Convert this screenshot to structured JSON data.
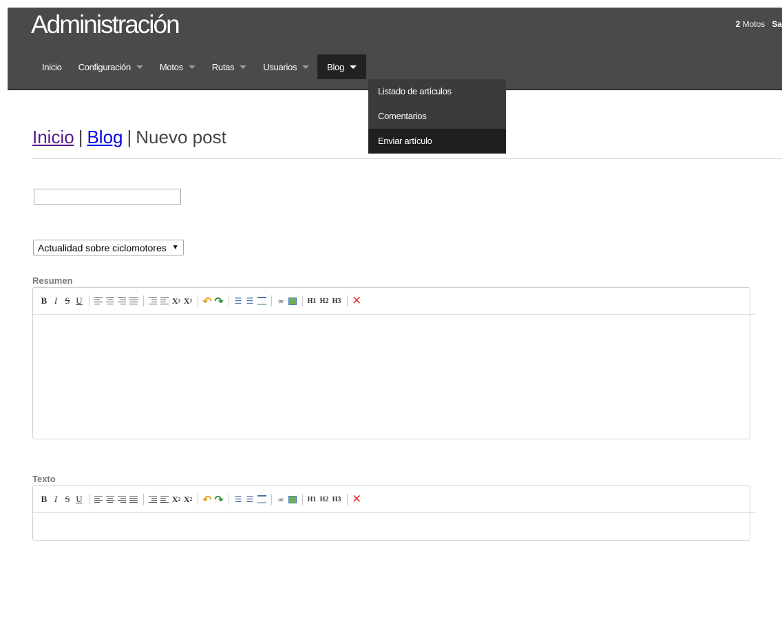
{
  "header": {
    "brand": "Administración",
    "right_count": "2",
    "right_label": "Motos",
    "right_extra": "Sa"
  },
  "nav": {
    "items": [
      {
        "label": "Inicio",
        "caret": false
      },
      {
        "label": "Configuración",
        "caret": true
      },
      {
        "label": "Motos",
        "caret": true
      },
      {
        "label": "Rutas",
        "caret": true
      },
      {
        "label": "Usuarios",
        "caret": true
      },
      {
        "label": "Blog",
        "caret": true,
        "active": true
      }
    ]
  },
  "dropdown": {
    "items": [
      {
        "label": "Listado de artículos"
      },
      {
        "label": "Comentarios"
      },
      {
        "label": "Enviar artículo",
        "selected": true
      }
    ]
  },
  "breadcrumb": {
    "home": "Inicio",
    "sep": "|",
    "section": "Blog",
    "current": "Nuevo post"
  },
  "form": {
    "title_value": "",
    "category_value": "Actualidad sobre ciclomotores",
    "summary_label": "Resumen",
    "text_label": "Texto"
  },
  "toolbar": {
    "bold": "B",
    "italic": "I",
    "strike": "S",
    "underline": "U",
    "sub": "X",
    "sub_mark": "2",
    "sup": "X",
    "sup_mark": "2",
    "h1": "H1",
    "h2": "H2",
    "h3": "H3"
  },
  "colors": {
    "header_bg": "#4a4a4a",
    "active_bg": "#222222",
    "dropdown_bg": "#3b3b3b",
    "undo": "#e3a200",
    "redo": "#2e8b2e",
    "clear": "#ee3333"
  }
}
